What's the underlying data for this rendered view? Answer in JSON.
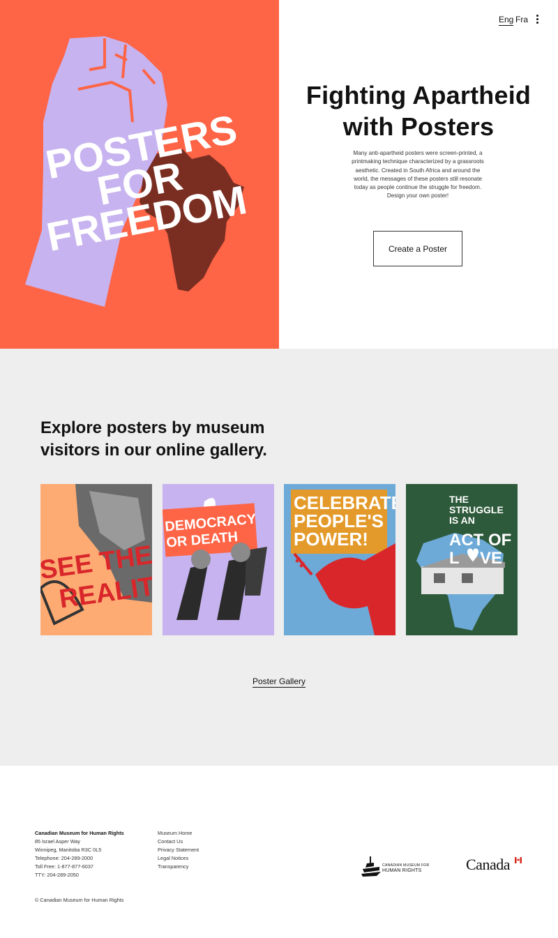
{
  "header": {
    "lang_eng": "Eng",
    "lang_fra": "Fra"
  },
  "hero": {
    "art_text": [
      "POSTERS",
      "FOR",
      "FREEDOM"
    ],
    "title": "Fighting Apartheid\nwith Posters",
    "description": "Many anti-apartheid posters were screen-printed, a printmaking technique characterized by a grassroots aesthetic. Created in South Africa and around the world, the messages of these posters still resonate today as people continue the struggle for freedom. Design your own poster!",
    "cta_label": "Create a Poster"
  },
  "gallery": {
    "title": "Explore posters by museum visitors in our online gallery.",
    "posters": [
      {
        "lines": [
          "SEE THE",
          "REALITY"
        ],
        "bg": "#fdab73"
      },
      {
        "lines": [
          "DEMOCRACY",
          "OR DEATH"
        ],
        "bg": "#c7b3ef"
      },
      {
        "lines": [
          "CELEBRATE",
          "PEOPLE'S",
          "POWER!"
        ],
        "bg": "#6eaad8"
      },
      {
        "lines": [
          "THE",
          "STRUGGLE",
          "IS AN",
          "ACT OF",
          "L",
          "VE"
        ],
        "bg": "#2d5a3a"
      }
    ],
    "link_label": "Poster Gallery"
  },
  "footer": {
    "address": {
      "org": "Canadian Museum for Human Rights",
      "street": "85 Israel Asper Way",
      "city": "Winnipeg, Manitoba R3C 0L5",
      "telephone": "Telephone: 204-289-2000",
      "toll_free": "Toll Free: 1-877-877-6037",
      "tty": "TTY: 204-289-2050"
    },
    "links": [
      "Museum Home",
      "Contact Us",
      "Privacy Statement",
      "Legal Notices",
      "Transparency"
    ],
    "copyright": "© Canadian Museum for Human Rights",
    "museum_logo": {
      "line1": "CANADIAN MUSEUM FOR",
      "line2": "HUMAN RIGHTS"
    },
    "canada_wordmark": "Canada"
  },
  "colors": {
    "hero_orange": "#fe6446",
    "fist_lavender": "#c7b3ef",
    "africa_brown": "#7a2e22",
    "gallery_bg": "#eeeeee",
    "poster_red": "#d9262a"
  }
}
